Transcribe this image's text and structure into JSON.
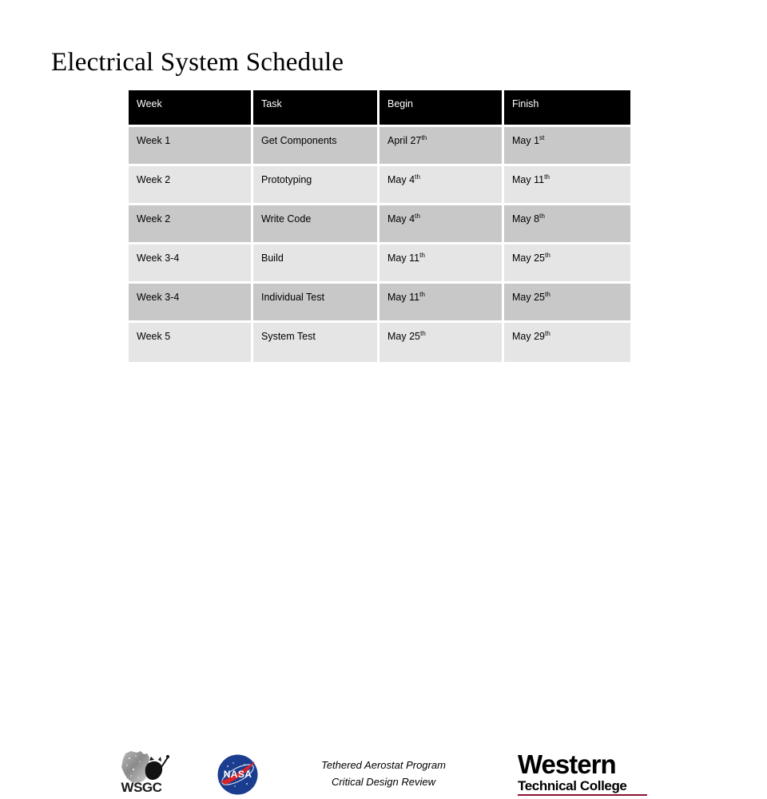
{
  "slide": {
    "title": "Electrical System Schedule"
  },
  "table": {
    "columns": [
      "Week",
      "Task",
      "Begin",
      "Finish"
    ],
    "rows": [
      {
        "week": "Week 1",
        "task": "Get Components",
        "begin": "April 27",
        "begin_sup": "th",
        "finish": "May 1",
        "finish_sup": "st"
      },
      {
        "week": "Week 2",
        "task": "Prototyping",
        "begin": "May 4",
        "begin_sup": "th",
        "finish": "May 11",
        "finish_sup": "th"
      },
      {
        "week": "Week 2",
        "task": "Write Code",
        "begin": "May 4",
        "begin_sup": "th",
        "finish": "May 8",
        "finish_sup": "th"
      },
      {
        "week": "Week 3-4",
        "task": "Build",
        "begin": "May 11",
        "begin_sup": "th",
        "finish": "May 25",
        "finish_sup": "th"
      },
      {
        "week": "Week 3-4",
        "task": "Individual Test",
        "begin": "May 11",
        "begin_sup": "th",
        "finish": "May 25",
        "finish_sup": "th"
      },
      {
        "week": "Week 5",
        "task": "System Test",
        "begin": "May 25",
        "begin_sup": "th",
        "finish": "May 29",
        "finish_sup": "th"
      }
    ]
  },
  "footer": {
    "wsgc_logo": {
      "wordmark": "WSGC",
      "icon": "wisconsin-badger-icon"
    },
    "nasa_logo": {
      "wordmark": "NASA",
      "icon": "nasa-meatball-icon",
      "circle_color": "#1b3d8f",
      "swoosh_color": "#d8232a"
    },
    "caption": {
      "line1": "Tethered Aerostat Program",
      "line2": "Critical Design Review"
    },
    "western_logo": {
      "main": "Western",
      "sub": "Technical College",
      "rule_color": "#8d1230"
    }
  },
  "colors": {
    "header_bg": "#000000",
    "header_text": "#ffffff",
    "row_dark": "#c8c8c8",
    "row_light": "#e5e5e5",
    "page_bg": "#ffffff"
  }
}
